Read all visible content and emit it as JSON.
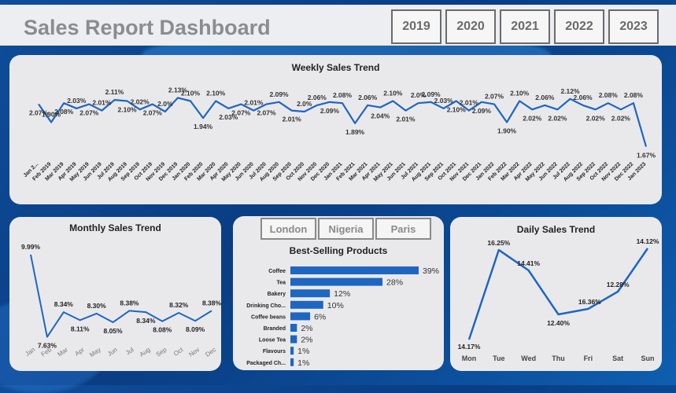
{
  "header": {
    "title": "Sales Report Dashboard",
    "years": [
      "2019",
      "2020",
      "2021",
      "2022",
      "2023"
    ]
  },
  "colors": {
    "line": "#1f66c1",
    "bar": "#1f66c1",
    "panel": "#e9e9ec",
    "background": "#0b4590"
  },
  "cities": [
    "London",
    "Nigeria",
    "Paris"
  ],
  "chart_data": [
    {
      "type": "line",
      "title": "Weekly Sales Trend",
      "x": [
        "Jan 2...",
        "Feb 2019",
        "Mar 2019",
        "Apr 2019",
        "May 2019",
        "Jun 2019",
        "Jul 2019",
        "Aug 2019",
        "Sep 2019",
        "Oct 2019",
        "Nov 2019",
        "Dec 2019",
        "Jan 2020",
        "Feb 2020",
        "Mar 2020",
        "Apr 2020",
        "May 2020",
        "Jun 2020",
        "Jul 2020",
        "Aug 2020",
        "Sep 2020",
        "Oct 2020",
        "Nov 2020",
        "Dec 2020",
        "Jan 2021",
        "Feb 2021",
        "Mar 2021",
        "Apr 2021",
        "May 2021",
        "Jun 2021",
        "Jul 2021",
        "Aug 2021",
        "Sep 2021",
        "Oct 2021",
        "Nov 2021",
        "Dec 2021",
        "Jan 2022",
        "Feb 2022",
        "Mar 2022",
        "Apr 2022",
        "May 2022",
        "Jun 2022",
        "Jul 2022",
        "Aug 2022",
        "Sep 2022",
        "Oct 2022",
        "Nov 2022",
        "Dec 2022",
        "Jan 2023"
      ],
      "values": [
        2.07,
        1.9,
        2.08,
        2.03,
        2.07,
        2.01,
        2.11,
        2.1,
        2.02,
        2.07,
        2.0,
        2.13,
        2.1,
        1.94,
        2.1,
        2.03,
        2.07,
        2.01,
        2.07,
        2.09,
        2.01,
        2.0,
        2.06,
        2.09,
        2.08,
        1.89,
        2.06,
        2.04,
        2.1,
        2.01,
        2.08,
        2.09,
        2.03,
        2.1,
        2.01,
        2.09,
        2.07,
        1.9,
        2.1,
        2.02,
        2.06,
        2.02,
        2.12,
        2.06,
        2.02,
        2.08,
        2.02,
        2.08,
        1.67
      ],
      "labels": [
        "2.07%",
        "1.90%",
        "2.08%",
        "2.03%",
        "2.07%",
        "2.01%",
        "2.11%",
        "2.10%",
        "2.02%",
        "2.07%",
        "2.0%",
        "2.13%",
        "2.10%",
        "1.94%",
        "2.10%",
        "2.03%",
        "2.07%",
        "2.01%",
        "2.07%",
        "2.09%",
        "2.01%",
        "2.0%",
        "2.06%",
        "2.09%",
        "2.08%",
        "1.89%",
        "2.06%",
        "2.04%",
        "2.10%",
        "2.01%",
        "2.0%",
        "2.09%",
        "2.03%",
        "2.10%",
        "2.01%",
        "2.09%",
        "2.07%",
        "1.90%",
        "2.10%",
        "2.02%",
        "2.06%",
        "2.02%",
        "2.12%",
        "2.06%",
        "2.02%",
        "2.08%",
        "2.02%",
        "2.08%",
        "1.67%"
      ],
      "label_pos": [
        "below",
        "above",
        "below",
        "above",
        "below",
        "above",
        "above",
        "below",
        "above",
        "below",
        "above",
        "above",
        "above",
        "below",
        "above",
        "below",
        "below",
        "above",
        "below",
        "above",
        "below",
        "above",
        "above",
        "below",
        "above",
        "below",
        "above",
        "below",
        "above",
        "below",
        "above",
        "above",
        "above",
        "below",
        "above",
        "below",
        "above",
        "below",
        "above",
        "below",
        "above",
        "below",
        "above",
        "above",
        "below",
        "above",
        "below",
        "above",
        "below"
      ],
      "ylim": [
        1.6,
        2.2
      ]
    },
    {
      "type": "line",
      "title": "Monthly Sales Trend",
      "x": [
        "Jan",
        "Feb",
        "Mar",
        "Apr",
        "May",
        "Jun",
        "Jul",
        "Aug",
        "Sep",
        "Oct",
        "Nov",
        "Dec"
      ],
      "values": [
        9.99,
        7.63,
        8.34,
        8.11,
        8.3,
        8.05,
        8.38,
        8.34,
        8.08,
        8.32,
        8.09,
        8.38
      ],
      "labels": [
        "9.99%",
        "7.63%",
        "8.34%",
        "8.11%",
        "8.30%",
        "8.05%",
        "8.38%",
        "8.34%",
        "8.08%",
        "8.32%",
        "8.09%",
        "8.38%"
      ],
      "ylim": [
        7.6,
        10.1
      ]
    },
    {
      "type": "bar",
      "title": "Best-Selling Products",
      "categories": [
        "Coffee",
        "Tea",
        "Bakery",
        "Drinking Cho...",
        "Coffee beans",
        "Branded",
        "Loose Tea",
        "Flavours",
        "Packaged Ch..."
      ],
      "values": [
        39,
        28,
        12,
        10,
        6,
        2,
        2,
        1,
        1
      ],
      "labels": [
        "39%",
        "28%",
        "12%",
        "10%",
        "6%",
        "2%",
        "2%",
        "1%",
        "1%"
      ]
    },
    {
      "type": "line",
      "title": "Daily Sales Trend",
      "x": [
        "Mon",
        "Tue",
        "Wed",
        "Thu",
        "Fri",
        "Sat",
        "Sun"
      ],
      "values": [
        14.17,
        16.25,
        14.41,
        12.4,
        16.36,
        12.28,
        14.12
      ],
      "labels": [
        "14.17%",
        "16.25%",
        "14.41%",
        "12.40%",
        "16.36%",
        "12.28%",
        "14.12%"
      ],
      "plot_y": [
        14.17,
        16.25,
        14.41,
        12.4,
        12.75,
        13.35,
        16.0
      ]
    }
  ]
}
